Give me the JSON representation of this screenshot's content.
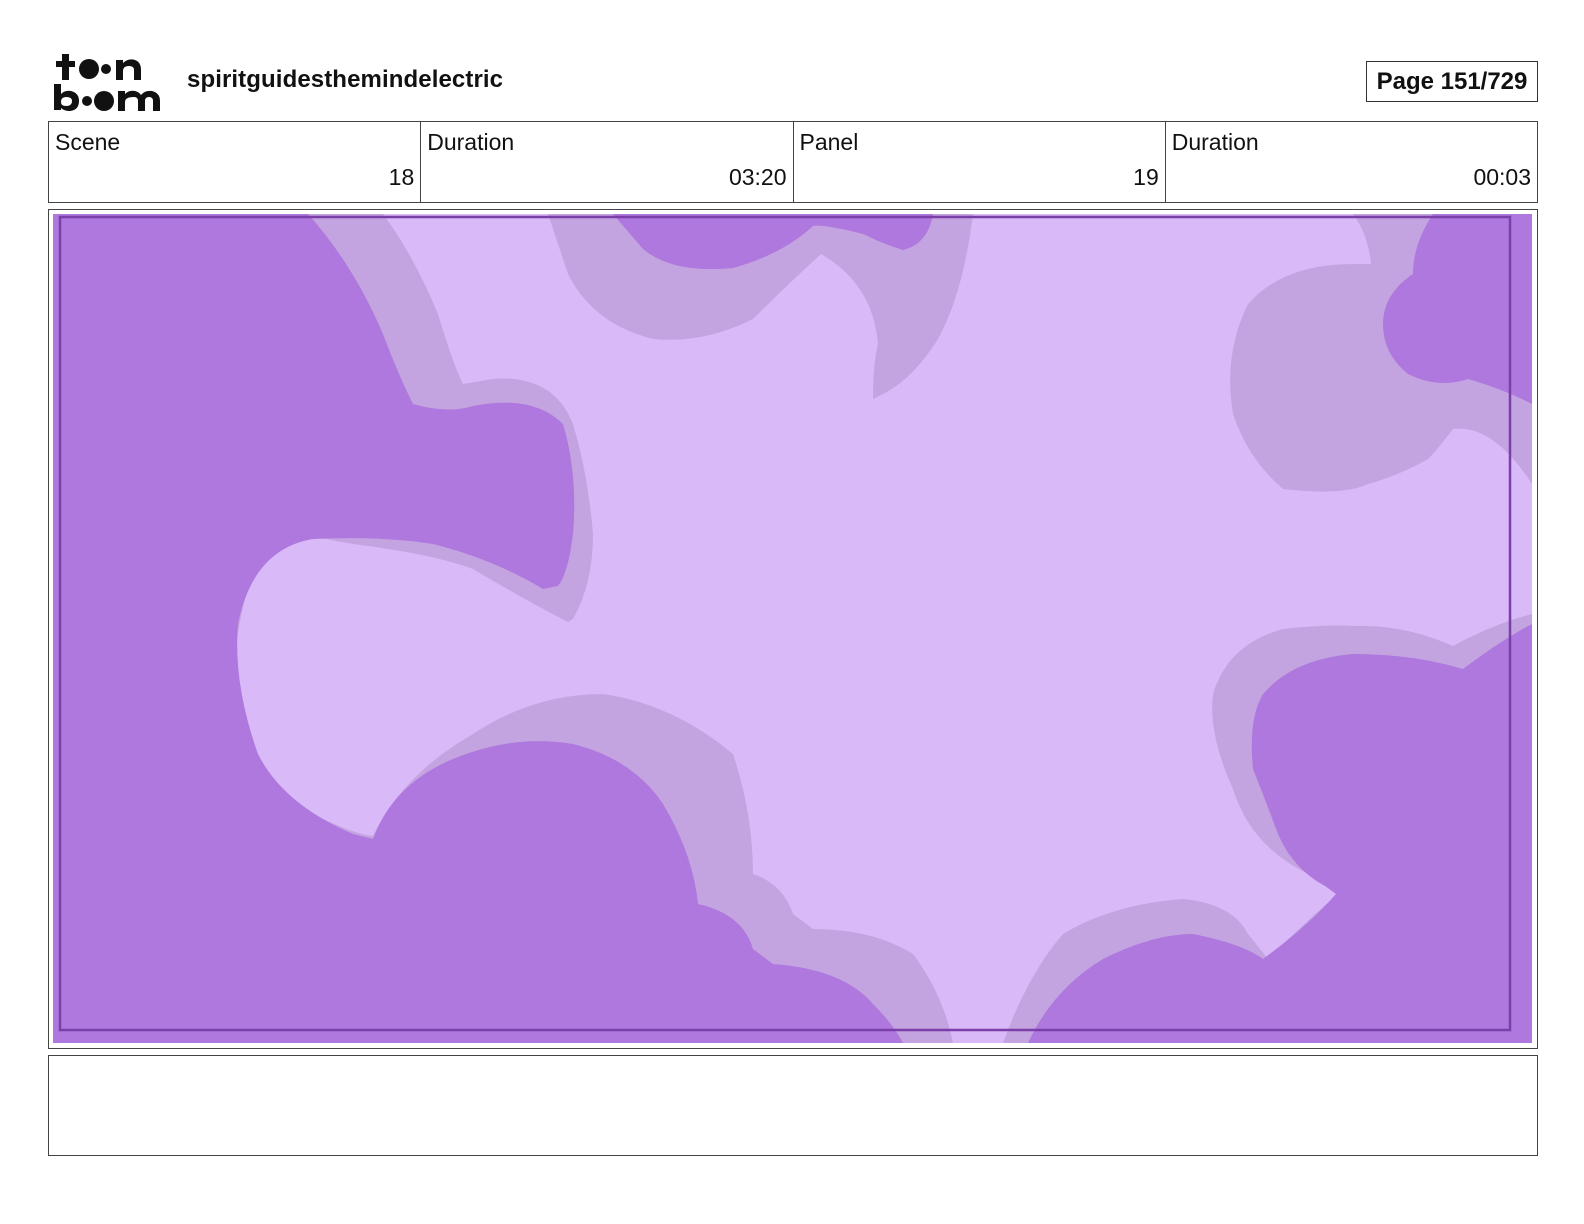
{
  "header": {
    "logo_icon": "toon-boom-logo",
    "project_title": "spiritguidesthemindelectric",
    "page_label": "Page 151/729"
  },
  "info": {
    "scene_label": "Scene",
    "scene_value": "18",
    "scene_duration_label": "Duration",
    "scene_duration_value": "03:20",
    "panel_label": "Panel",
    "panel_value": "19",
    "panel_duration_label": "Duration",
    "panel_duration_value": "00:03"
  },
  "panel": {
    "art_icon": "purple-cloud-frame",
    "colors": {
      "sky": "#dab9f9",
      "cloud_rim": "#c4a4e0",
      "cloud": "#ae78de",
      "frame_line": "#7a3fa8"
    }
  },
  "notes": {
    "text": ""
  }
}
